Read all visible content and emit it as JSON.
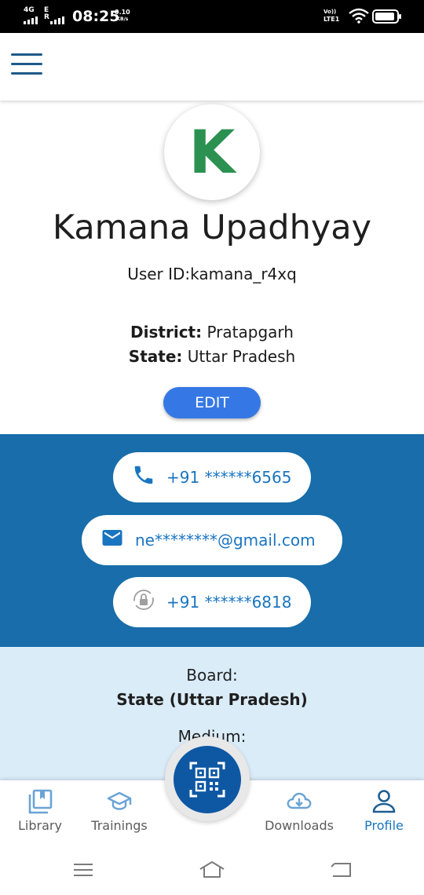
{
  "status_bar": {
    "network_top": "4G",
    "network_mid": "E",
    "network_sub": "R",
    "time": "08:25",
    "speed_value": "0.10",
    "speed_unit": "KB/s",
    "volte_top": "Vo))",
    "volte_bottom": "LTE1"
  },
  "header": {
    "menu_icon": "hamburger-menu-icon"
  },
  "profile": {
    "avatar_letter": "K",
    "name": "Kamana Upadhyay",
    "user_id": "User ID:kamana_r4xq",
    "district_label": "District:",
    "district_value": "Pratapgarh",
    "state_label": "State:",
    "state_value": "Uttar Pradesh",
    "edit_label": "EDIT"
  },
  "contacts": {
    "phone": "+91 ******6565",
    "email": "ne********@gmail.com",
    "recovery_phone": "+91 ******6818"
  },
  "board": {
    "board_label": "Board:",
    "board_value": "State (Uttar Pradesh)",
    "medium_label": "Medium:"
  },
  "bottom_nav": {
    "items": [
      {
        "label": "Library",
        "icon": "library-icon"
      },
      {
        "label": "Trainings",
        "icon": "graduation-cap-icon"
      },
      {
        "label": "Downloads",
        "icon": "cloud-download-icon"
      },
      {
        "label": "Profile",
        "icon": "person-icon"
      }
    ],
    "scan_icon": "qr-scan-icon",
    "active": "Profile"
  },
  "colors": {
    "brand_blue": "#186daa",
    "accent_blue": "#1a75c0",
    "edit_button": "#3578e5",
    "avatar_green": "#2b9150",
    "board_bg": "#dbecf9"
  }
}
